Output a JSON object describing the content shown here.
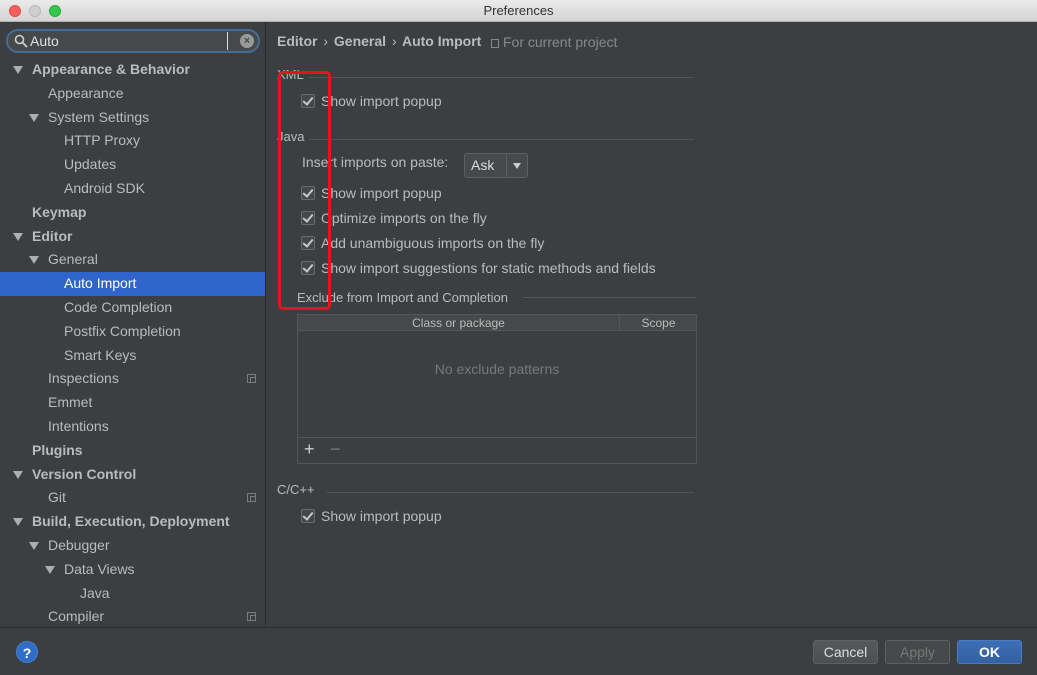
{
  "window": {
    "title": "Preferences"
  },
  "search": {
    "value": "Auto",
    "placeholder": ""
  },
  "sidebar": {
    "items": [
      {
        "label": "Appearance & Behavior",
        "level": 0,
        "bold": true,
        "expanded": true
      },
      {
        "label": "Appearance",
        "level": 1
      },
      {
        "label": "System Settings",
        "level": 1,
        "expanded": true
      },
      {
        "label": "HTTP Proxy",
        "level": 2
      },
      {
        "label": "Updates",
        "level": 2
      },
      {
        "label": "Android SDK",
        "level": 2
      },
      {
        "label": "Keymap",
        "level": 0,
        "bold": true
      },
      {
        "label": "Editor",
        "level": 0,
        "bold": true,
        "expanded": true
      },
      {
        "label": "General",
        "level": 1,
        "expanded": true
      },
      {
        "label": "Auto Import",
        "level": 2,
        "selected": true
      },
      {
        "label": "Code Completion",
        "level": 2
      },
      {
        "label": "Postfix Completion",
        "level": 2
      },
      {
        "label": "Smart Keys",
        "level": 2
      },
      {
        "label": "Inspections",
        "level": 1,
        "project": true
      },
      {
        "label": "Emmet",
        "level": 1
      },
      {
        "label": "Intentions",
        "level": 1
      },
      {
        "label": "Plugins",
        "level": 0,
        "bold": true
      },
      {
        "label": "Version Control",
        "level": 0,
        "bold": true,
        "expanded": true
      },
      {
        "label": "Git",
        "level": 1,
        "project": true
      },
      {
        "label": "Build, Execution, Deployment",
        "level": 0,
        "bold": true,
        "expanded": true
      },
      {
        "label": "Debugger",
        "level": 1,
        "expanded": true
      },
      {
        "label": "Data Views",
        "level": 2,
        "expanded": true
      },
      {
        "label": "Java",
        "level": 3
      },
      {
        "label": "Compiler",
        "level": 1,
        "project": true
      }
    ]
  },
  "breadcrumb": {
    "part1": "Editor",
    "part2": "General",
    "part3": "Auto Import",
    "separator": "›"
  },
  "project_note": "For current project",
  "xml": {
    "title": "XML",
    "show_popup": "Show import popup"
  },
  "java": {
    "title": "Java",
    "paste_label": "Insert imports on paste:",
    "paste_value": "Ask",
    "show_popup": "Show import popup",
    "optimize": "Optimize imports on the fly",
    "unambiguous": "Add unambiguous imports on the fly",
    "static_suggest": "Show import suggestions for static methods and fields"
  },
  "exclude": {
    "title": "Exclude from Import and Completion",
    "col_class": "Class or package",
    "col_scope": "Scope",
    "empty": "No exclude patterns",
    "add": "+",
    "remove": "−"
  },
  "cpp": {
    "title": "C/C++",
    "show_popup": "Show import popup"
  },
  "footer": {
    "help": "?",
    "cancel": "Cancel",
    "apply": "Apply",
    "ok": "OK"
  },
  "colors": {
    "selection": "#2f65ca",
    "highlight": "#e5141c",
    "background": "#3c3f41"
  }
}
